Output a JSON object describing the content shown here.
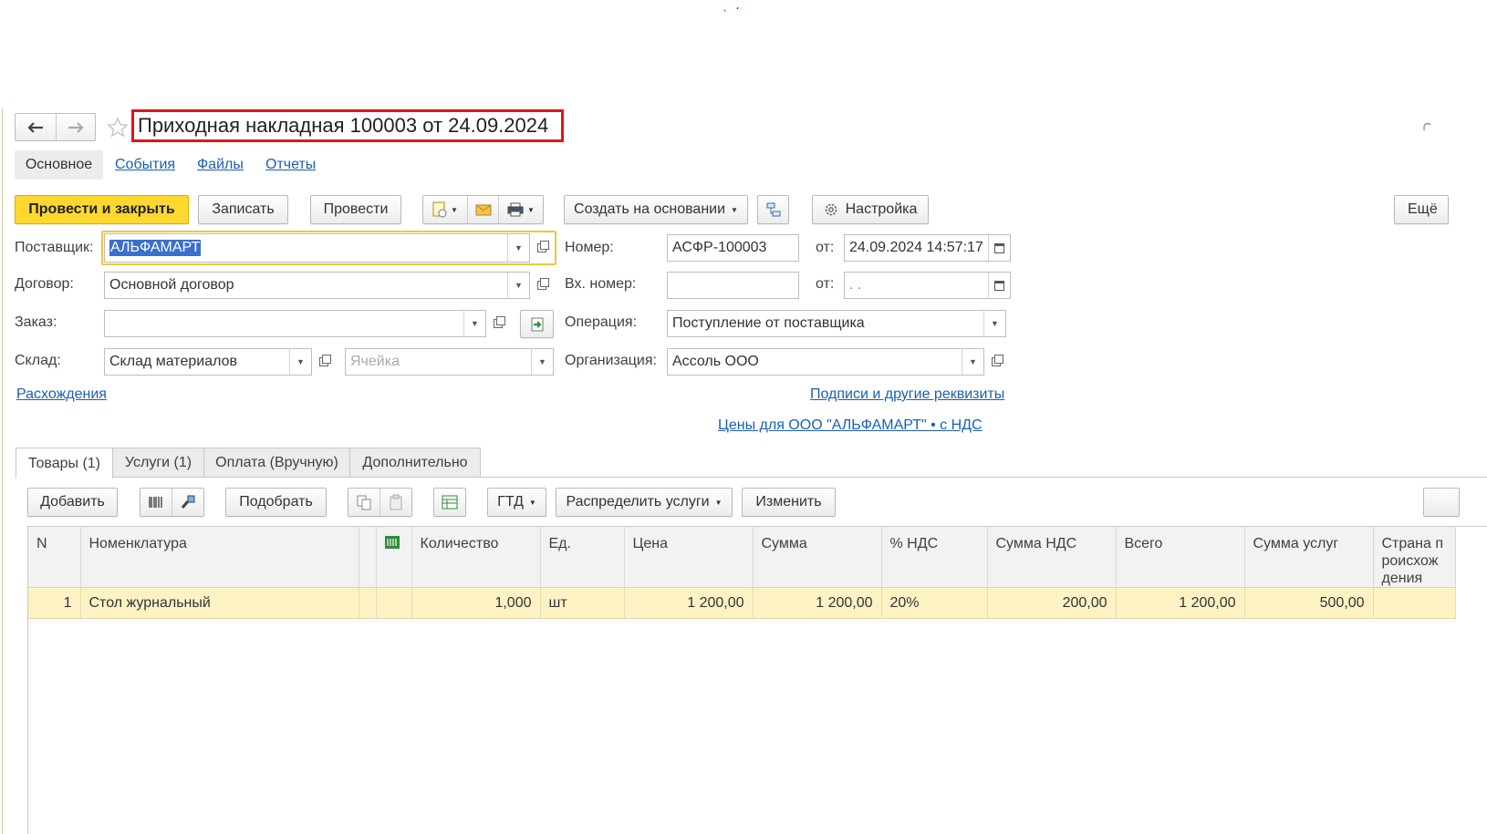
{
  "window": {
    "title": "Приходная накладная 100003 от 24.09.2024"
  },
  "nav": {
    "back_icon": "arrow-left-icon",
    "forward_icon": "arrow-right-icon",
    "favorite_icon": "star-icon"
  },
  "sections": [
    "Основное",
    "События",
    "Файлы",
    "Отчеты"
  ],
  "toolbar": {
    "post_close": "Провести и закрыть",
    "save": "Записать",
    "post": "Провести",
    "create_based": "Создать на основании",
    "settings": "Настройка",
    "more": "Ещё"
  },
  "form": {
    "supplier": {
      "label": "Поставщик:",
      "value": "АЛЬФАМАРТ"
    },
    "contract": {
      "label": "Договор:",
      "value": "Основной договор"
    },
    "order": {
      "label": "Заказ:",
      "value": ""
    },
    "warehouse": {
      "label": "Склад:",
      "value": "Склад материалов"
    },
    "cell": {
      "placeholder": "Ячейка"
    },
    "number": {
      "label": "Номер:",
      "value": "АСФР-100003"
    },
    "date_from_label": "от:",
    "date": "24.09.2024 14:57:17",
    "in_number": {
      "label": "Вх. номер:",
      "value": ""
    },
    "in_date_from_label": "от:",
    "in_date": " .  .",
    "operation": {
      "label": "Операция:",
      "value": "Поступление от поставщика"
    },
    "organization": {
      "label": "Организация:",
      "value": "Ассоль ООО"
    }
  },
  "links": {
    "discrepancies": "Расхождения",
    "signatures": "Подписи и другие реквизиты",
    "prices": "Цены для ООО \"АЛЬФАМАРТ\" • с НДС"
  },
  "tabs": [
    "Товары (1)",
    "Услуги (1)",
    "Оплата (Вручную)",
    "Дополнительно"
  ],
  "table_toolbar": {
    "add": "Добавить",
    "pick": "Подобрать",
    "gtd": "ГТД",
    "distribute": "Распределить услуги",
    "change": "Изменить"
  },
  "table": {
    "headers": [
      "N",
      "Номенклатура",
      "",
      "",
      "Количество",
      "Ед.",
      "Цена",
      "Сумма",
      "% НДС",
      "Сумма НДС",
      "Всего",
      "Сумма услуг",
      "Страна происхождения"
    ],
    "rows": [
      [
        "1",
        "Стол журнальный",
        "",
        "",
        "1,000",
        "шт",
        "1 200,00",
        "1 200,00",
        "20%",
        "200,00",
        "1 200,00",
        "500,00",
        ""
      ]
    ]
  },
  "colors": {
    "primary_button": "#ffd82f",
    "title_highlight": "#e0141c",
    "link": "#1a5fb4",
    "selected_row": "#fcf2c4"
  }
}
